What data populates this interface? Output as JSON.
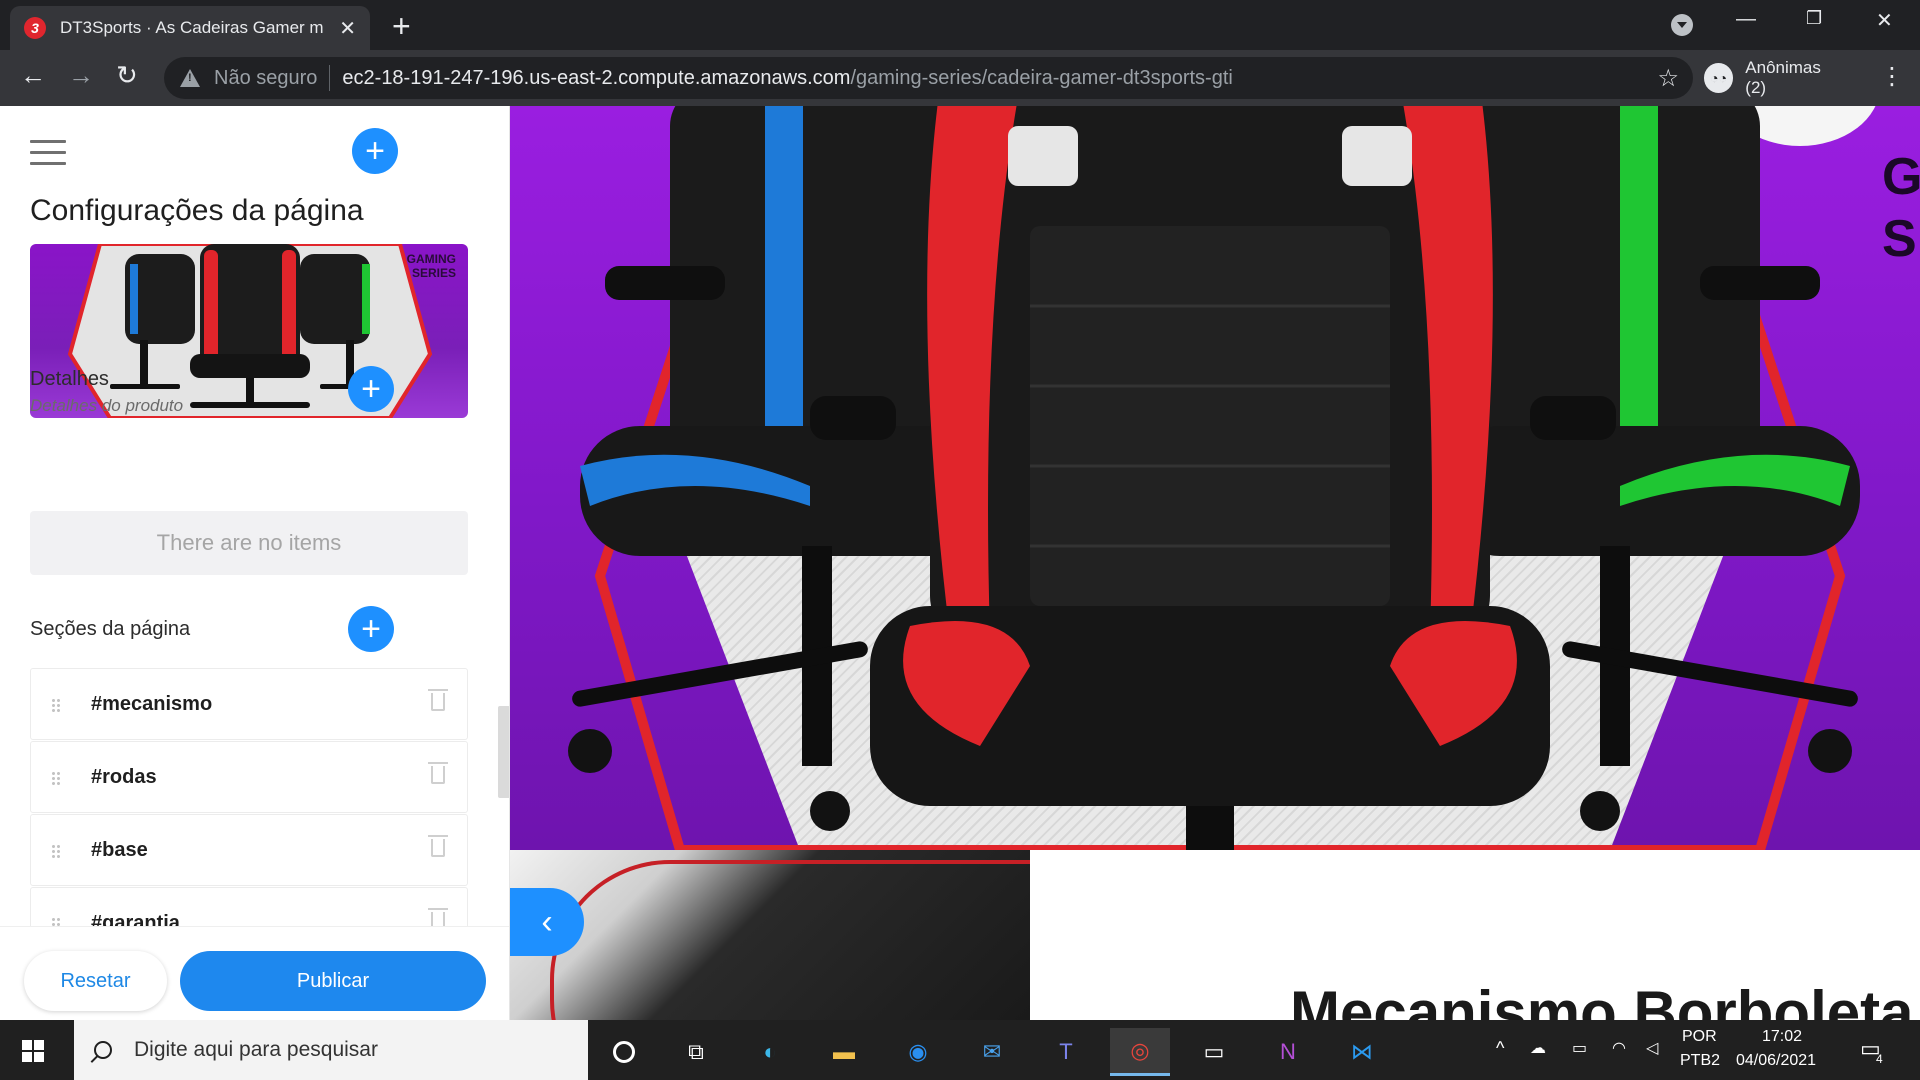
{
  "browser": {
    "tab_title": "DT3Sports · As Cadeiras Gamer m",
    "favicon_text": "3",
    "new_tab": "+",
    "close": "✕",
    "not_secure": "Não seguro",
    "url_host": "ec2-18-191-247-196.us-east-2.compute.amazonaws.com",
    "url_path": "/gaming-series/cadeira-gamer-dt3sports-gti",
    "incognito_label": "Anônimas (2)"
  },
  "panel": {
    "title": "Configurações da página",
    "thumb_series": "GAMING\nSERIES",
    "details": {
      "label": "Detalhes",
      "sublabel": "Detalhes do produto",
      "empty_text": "There are no items"
    },
    "sections": {
      "label": "Seções da página",
      "items": [
        {
          "label": "#mecanismo"
        },
        {
          "label": "#rodas"
        },
        {
          "label": "#base"
        },
        {
          "label": "#garantia"
        }
      ]
    },
    "footer": {
      "reset_label": "Resetar",
      "publish_label": "Publicar"
    }
  },
  "preview": {
    "hero_text": "GA\nS",
    "lower_heading": "Mecanismo Borboleta",
    "chair_colors": {
      "left": "#1e7ad8",
      "center": "#e1252b",
      "right": "#1fc633"
    }
  },
  "taskbar": {
    "search_placeholder": "Digite aqui para pesquisar",
    "lang_top": "POR",
    "lang_bottom": "PTB2",
    "time": "17:02",
    "date": "04/06/2021",
    "notification_count": "4"
  },
  "icons": {
    "accent": "#1e90ff",
    "hero_purple": "#8a18d0"
  }
}
